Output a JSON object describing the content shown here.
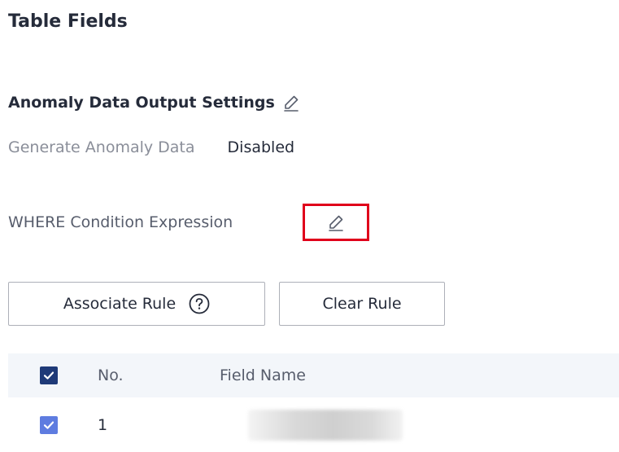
{
  "section": {
    "title": "Table Fields"
  },
  "anomaly": {
    "title": "Anomaly Data Output Settings",
    "generate_label": "Generate Anomaly Data",
    "generate_value": "Disabled"
  },
  "where": {
    "label": "WHERE Condition Expression"
  },
  "buttons": {
    "associate_label": "Associate Rule",
    "clear_label": "Clear Rule"
  },
  "table": {
    "columns": [
      "No.",
      "Field Name"
    ],
    "rows": [
      {
        "no": "1",
        "field_name": ""
      }
    ]
  },
  "colors": {
    "highlight_border": "#e0001b",
    "checkbox_checked": "#5e7ce0",
    "header_checkbox": "#1f3a78",
    "header_bg": "#f3f6fa"
  },
  "icons": {
    "edit": "pencil-icon",
    "help": "question-circle-icon",
    "check": "checkmark-icon"
  }
}
